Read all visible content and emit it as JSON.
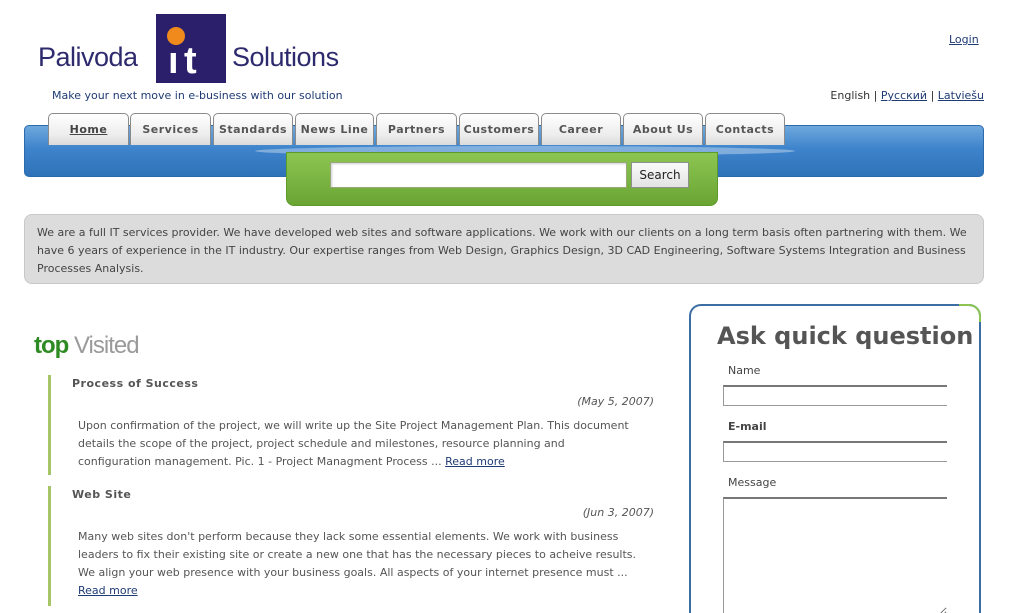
{
  "logo": {
    "left_word": "Palivoda",
    "it": "IT",
    "right_word": "Solutions"
  },
  "tagline": "Make your next move in e-business with our solution",
  "login": "Login",
  "languages": {
    "current": "English",
    "sep": "|",
    "ru": "Русский",
    "lv": "Latviešu"
  },
  "nav": {
    "tabs": [
      "Home",
      "Services",
      "Standards",
      "News Line",
      "Partners",
      "Customers",
      "Career",
      "About Us",
      "Contacts"
    ],
    "active": "Home"
  },
  "search": {
    "button": "Search",
    "value": ""
  },
  "intro": "We are a full IT services provider. We have developed web sites and software applications. We work with our clients on a long term basis often partnering with them. We have 6 years of experience in the IT industry. Our expertise ranges from Web Design, Graphics Design, 3D CAD Engineering, Software Systems Integration and Business Processes Analysis.",
  "top_visited": {
    "title_top": "top",
    "title_visited": "Visited",
    "articles": [
      {
        "title": "Process of Success",
        "date": "(May 5, 2007)",
        "body": "Upon confirmation of the project, we will write up the Site Project Management Plan. This document details the scope of the project, project schedule and milestones, resource planning and configuration management. Pic. 1 - Project Managment Process ...",
        "read_more": "Read more"
      },
      {
        "title": "Web Site",
        "date": "(Jun 3, 2007)",
        "body": "Many web sites don't perform because they lack some essential elements. We work with business leaders to fix their existing site or create a new one that has the necessary pieces to acheive results. We align your web presence with your business goals. All aspects of your internet presence must ...",
        "read_more": "Read more"
      }
    ]
  },
  "ask": {
    "title": "Ask quick question",
    "name_label": "Name",
    "email_label": "E-mail",
    "message_label": "Message"
  }
}
